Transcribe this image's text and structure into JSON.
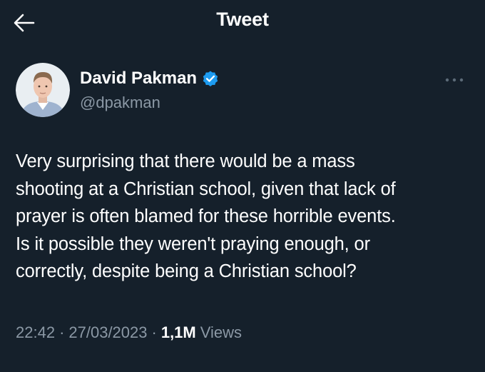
{
  "header": {
    "title": "Tweet",
    "back_icon": "arrow-left-icon"
  },
  "author": {
    "name": "David Pakman",
    "handle": "@dpakman",
    "verified": true,
    "verified_color": "#1d9bf0"
  },
  "tweet": {
    "text": "Very surprising that there would be a mass\nshooting at a Christian school, given that lack of\nprayer is often blamed for these horrible events.\nIs it possible they weren't praying enough, or\ncorrectly, despite being a Christian school?"
  },
  "meta": {
    "time": "22:42",
    "separator": "·",
    "date": "27/03/2023",
    "views_count": "1,1M",
    "views_label": "Views"
  },
  "colors": {
    "background": "#15202b",
    "secondary_text": "#8b98a5",
    "primary_text": "#ffffff"
  }
}
